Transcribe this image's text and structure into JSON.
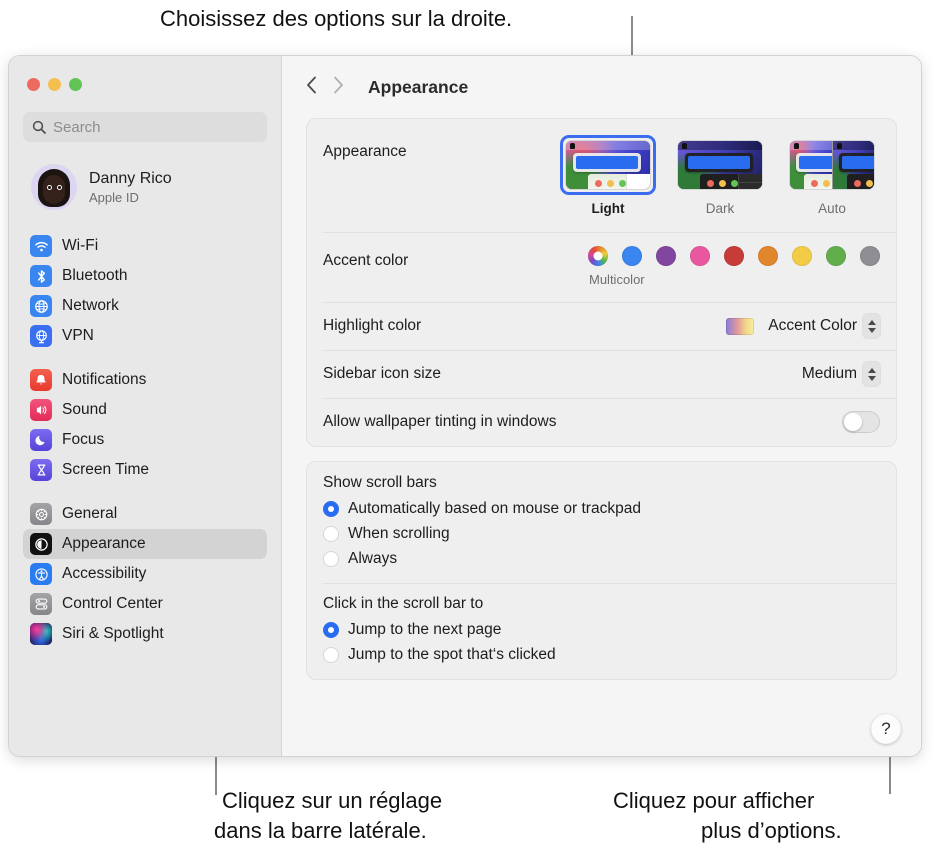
{
  "annotations": {
    "top": "Choisissez des options sur la droite.",
    "bottom_left_line1": "Cliquez sur un réglage",
    "bottom_left_line2": "dans la barre latérale.",
    "bottom_right_line1": "Cliquez pour afficher",
    "bottom_right_line2": "plus d’options."
  },
  "window": {
    "traffic_lights": [
      "close-button",
      "minimize-button",
      "zoom-button"
    ]
  },
  "sidebar": {
    "search": {
      "placeholder": "Search",
      "value": "",
      "icon": "search-icon"
    },
    "account": {
      "name": "Danny Rico",
      "subtitle": "Apple ID",
      "avatar": "memoji-avatar"
    },
    "groups": [
      {
        "items": [
          {
            "label": "Wi-Fi",
            "icon": "wifi-icon",
            "color": "#3a86f0",
            "selected": false
          },
          {
            "label": "Bluetooth",
            "icon": "bluetooth-icon",
            "color": "#3a86f0",
            "selected": false
          },
          {
            "label": "Network",
            "icon": "globe-icon",
            "color": "#3a86f0",
            "selected": false
          },
          {
            "label": "VPN",
            "icon": "vpn-globe-icon",
            "color": "#3a6ff0",
            "selected": false
          }
        ]
      },
      {
        "items": [
          {
            "label": "Notifications",
            "icon": "bell-icon",
            "color": "#f04a3c",
            "selected": false
          },
          {
            "label": "Sound",
            "icon": "speaker-icon",
            "color": "#ee3b64",
            "selected": false
          },
          {
            "label": "Focus",
            "icon": "moon-icon",
            "color": "#6a5bea",
            "selected": false
          },
          {
            "label": "Screen Time",
            "icon": "hourglass-icon",
            "color": "#6a5bea",
            "selected": false
          }
        ]
      },
      {
        "items": [
          {
            "label": "General",
            "icon": "gear-icon",
            "color": "#8e8e93",
            "selected": false
          },
          {
            "label": "Appearance",
            "icon": "appearance-icon",
            "color": "#111111",
            "selected": true
          },
          {
            "label": "Accessibility",
            "icon": "accessibility-icon",
            "color": "#2a7cf0",
            "selected": false
          },
          {
            "label": "Control Center",
            "icon": "control-center-icon",
            "color": "#8e8e93",
            "selected": false
          },
          {
            "label": "Siri & Spotlight",
            "icon": "siri-icon",
            "color": "#5b3fd0",
            "selected": false
          }
        ]
      }
    ]
  },
  "toolbar": {
    "back_icon": "chevron-left-icon",
    "forward_icon": "chevron-right-icon",
    "title": "Appearance"
  },
  "main": {
    "appearance": {
      "label": "Appearance",
      "options": [
        {
          "name": "Light",
          "selected": true
        },
        {
          "name": "Dark",
          "selected": false
        },
        {
          "name": "Auto",
          "selected": false
        }
      ]
    },
    "accent_color": {
      "label": "Accent color",
      "caption": "Multicolor",
      "swatches": [
        {
          "name": "Multicolor",
          "color": "multicolor",
          "selected": true
        },
        {
          "name": "Blue",
          "color": "#3a86f0",
          "selected": false
        },
        {
          "name": "Purple",
          "color": "#8146a0",
          "selected": false
        },
        {
          "name": "Pink",
          "color": "#e9589e",
          "selected": false
        },
        {
          "name": "Red",
          "color": "#c83c38",
          "selected": false
        },
        {
          "name": "Orange",
          "color": "#e2862d",
          "selected": false
        },
        {
          "name": "Yellow",
          "color": "#f2cc46",
          "selected": false
        },
        {
          "name": "Green",
          "color": "#63ae4c",
          "selected": false
        },
        {
          "name": "Graphite",
          "color": "#8e8e93",
          "selected": false
        }
      ]
    },
    "highlight_color": {
      "label": "Highlight color",
      "value": "Accent Color",
      "chip": "accent-gradient-chip"
    },
    "sidebar_icon_size": {
      "label": "Sidebar icon size",
      "value": "Medium"
    },
    "wallpaper_tinting": {
      "label": "Allow wallpaper tinting in windows",
      "enabled": false
    },
    "scroll_bars": {
      "title": "Show scroll bars",
      "options": [
        {
          "label": "Automatically based on mouse or trackpad",
          "selected": true
        },
        {
          "label": "When scrolling",
          "selected": false
        },
        {
          "label": "Always",
          "selected": false
        }
      ]
    },
    "scroll_bar_click": {
      "title": "Click in the scroll bar to",
      "options": [
        {
          "label": "Jump to the next page",
          "selected": true
        },
        {
          "label": "Jump to the spot that‘s clicked",
          "selected": false
        }
      ]
    },
    "help_button": {
      "label": "?"
    }
  }
}
